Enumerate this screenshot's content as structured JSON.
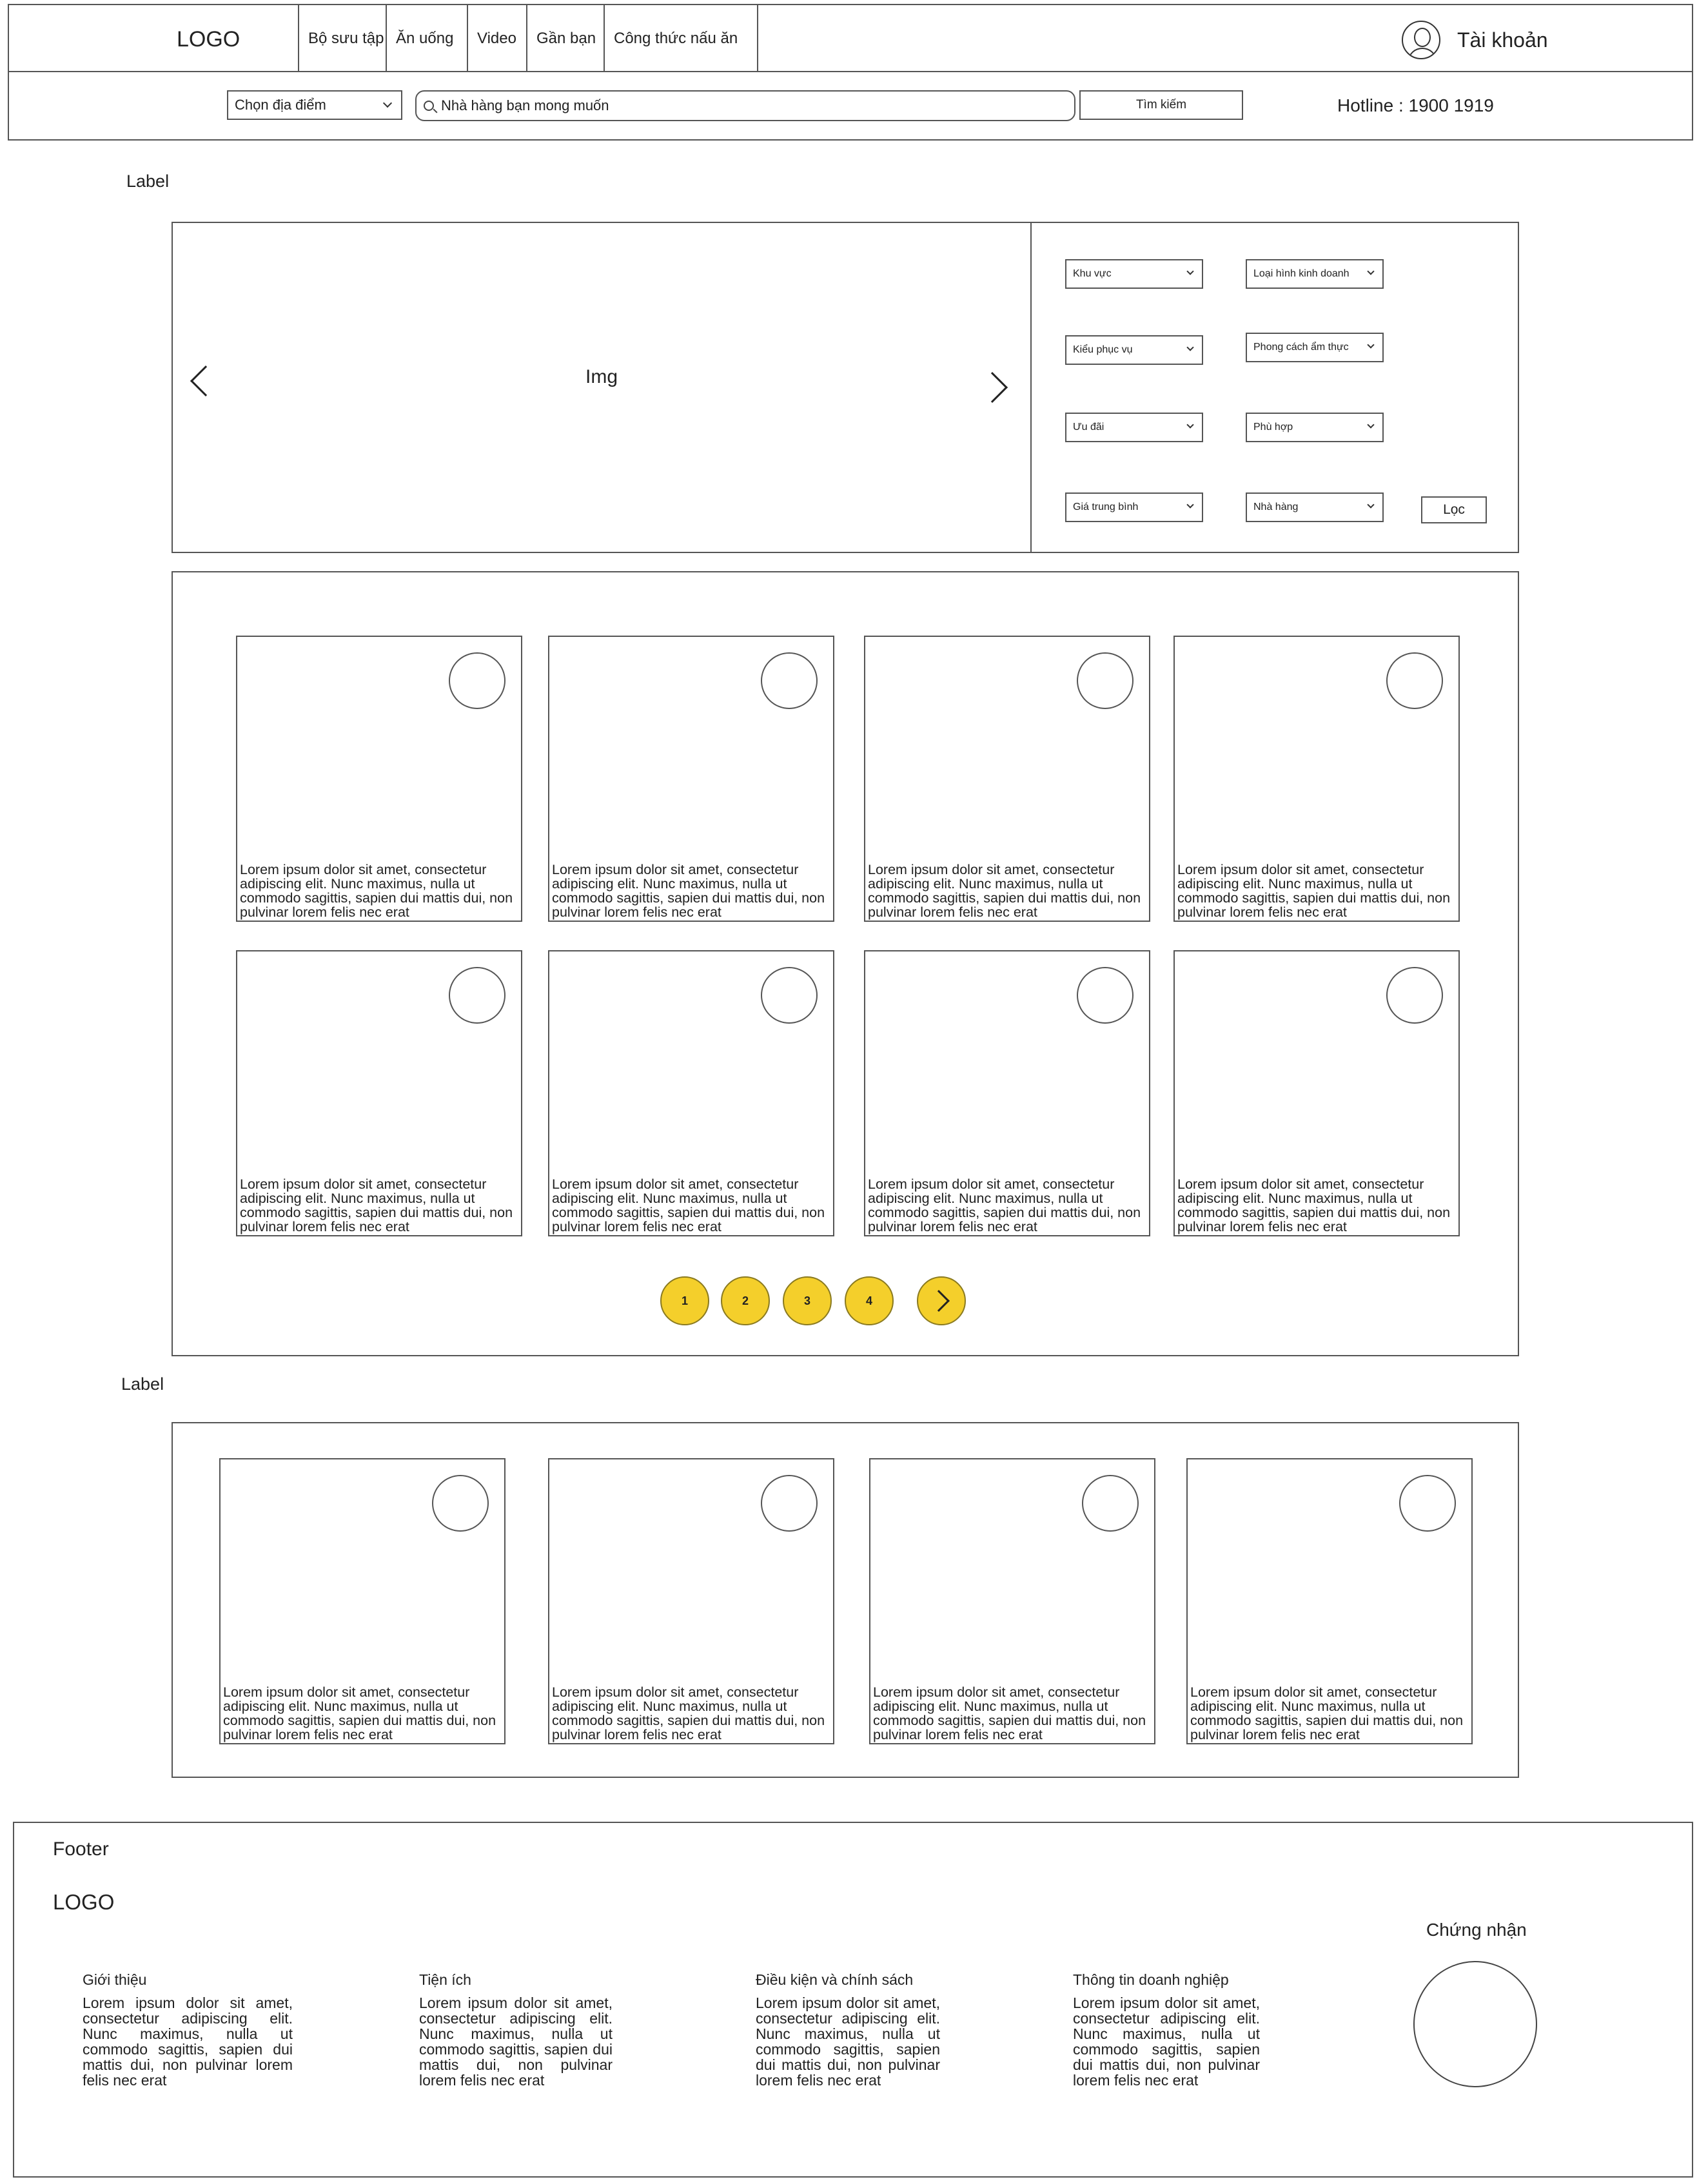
{
  "header": {
    "logo": "LOGO",
    "nav": [
      "Bộ sưu tập",
      "Ăn uống",
      "Video",
      "Gần bạn",
      "Công thức nấu ăn"
    ],
    "account_label": "Tài  khoản",
    "location_select": "Chọn địa điểm",
    "search_placeholder": "Nhà hàng bạn mong muốn",
    "search_button": "Tìm kiếm",
    "hotline": "Hotline : 1900 1919"
  },
  "section1_label": "Label",
  "hero": {
    "image_label": "Img",
    "filters": [
      "Khu vực",
      "Loại hình kinh doanh",
      "Kiểu phục vụ",
      "Phong cách ẩm thực",
      "Ưu đãi",
      "Phù hợp",
      "Giá trung bình",
      "Nhà hàng"
    ],
    "filter_button": "Lọc"
  },
  "grid_cards": [
    "Lorem ipsum dolor sit amet, consectetur adipiscing elit. Nunc maximus, nulla ut commodo sagittis, sapien dui mattis dui, non pulvinar lorem felis nec erat",
    "Lorem ipsum dolor sit amet, consectetur adipiscing elit. Nunc maximus, nulla ut commodo sagittis, sapien dui mattis dui, non pulvinar lorem felis nec erat",
    "Lorem ipsum dolor sit amet, consectetur adipiscing elit. Nunc maximus, nulla ut commodo sagittis, sapien dui mattis dui, non pulvinar lorem felis nec erat",
    "Lorem ipsum dolor sit amet, consectetur adipiscing elit. Nunc maximus, nulla ut commodo sagittis, sapien dui mattis dui, non pulvinar lorem felis nec erat",
    "Lorem ipsum dolor sit amet, consectetur adipiscing elit. Nunc maximus, nulla ut commodo sagittis, sapien dui mattis dui, non pulvinar lorem felis nec erat",
    "Lorem ipsum dolor sit amet, consectetur adipiscing elit. Nunc maximus, nulla ut commodo sagittis, sapien dui mattis dui, non pulvinar lorem felis nec erat",
    "Lorem ipsum dolor sit amet, consectetur adipiscing elit. Nunc maximus, nulla ut commodo sagittis, sapien dui mattis dui, non pulvinar lorem felis nec erat",
    "Lorem ipsum dolor sit amet, consectetur adipiscing elit. Nunc maximus, nulla ut commodo sagittis, sapien dui mattis dui, non pulvinar lorem felis nec erat"
  ],
  "pagination": {
    "pages": [
      "1",
      "2",
      "3",
      "4"
    ],
    "accent_color": "#f4cf2b"
  },
  "section2_label": "Label",
  "section2_cards": [
    "Lorem ipsum dolor sit amet, consectetur adipiscing elit. Nunc maximus, nulla ut commodo sagittis, sapien dui mattis dui, non pulvinar lorem felis nec erat",
    "Lorem ipsum dolor sit amet, consectetur adipiscing elit. Nunc maximus, nulla ut commodo sagittis, sapien dui mattis dui, non pulvinar lorem felis nec erat",
    "Lorem ipsum dolor sit amet, consectetur adipiscing elit. Nunc maximus, nulla ut commodo sagittis, sapien dui mattis dui, non pulvinar lorem felis nec erat",
    "Lorem ipsum dolor sit amet, consectetur adipiscing elit. Nunc maximus, nulla ut commodo sagittis, sapien dui mattis dui, non pulvinar lorem felis nec erat"
  ],
  "footer": {
    "title": "Footer",
    "logo": "LOGO",
    "columns": [
      {
        "title": "Giới thiệu",
        "text": "Lorem ipsum dolor sit amet, consectetur adipiscing elit. Nunc maximus, nulla ut commodo sagittis, sapien dui mattis dui, non pulvinar lorem felis nec erat"
      },
      {
        "title": "Tiện ích",
        "text": "Lorem ipsum dolor sit amet, consectetur adipiscing elit. Nunc maximus, nulla ut commodo sagittis, sapien dui mattis dui, non pulvinar lorem felis nec erat"
      },
      {
        "title": "Điều kiện và chính sách",
        "text": "Lorem ipsum dolor sit amet, consectetur adipiscing elit. Nunc maximus, nulla ut commodo sagittis, sapien dui mattis dui, non pulvinar lorem felis nec erat"
      },
      {
        "title": "Thông tin doanh nghiệp",
        "text": "Lorem ipsum dolor sit amet, consectetur adipiscing elit. Nunc maximus, nulla ut commodo sagittis, sapien dui mattis dui, non pulvinar lorem felis nec erat"
      }
    ],
    "certification": "Chứng nhận"
  }
}
